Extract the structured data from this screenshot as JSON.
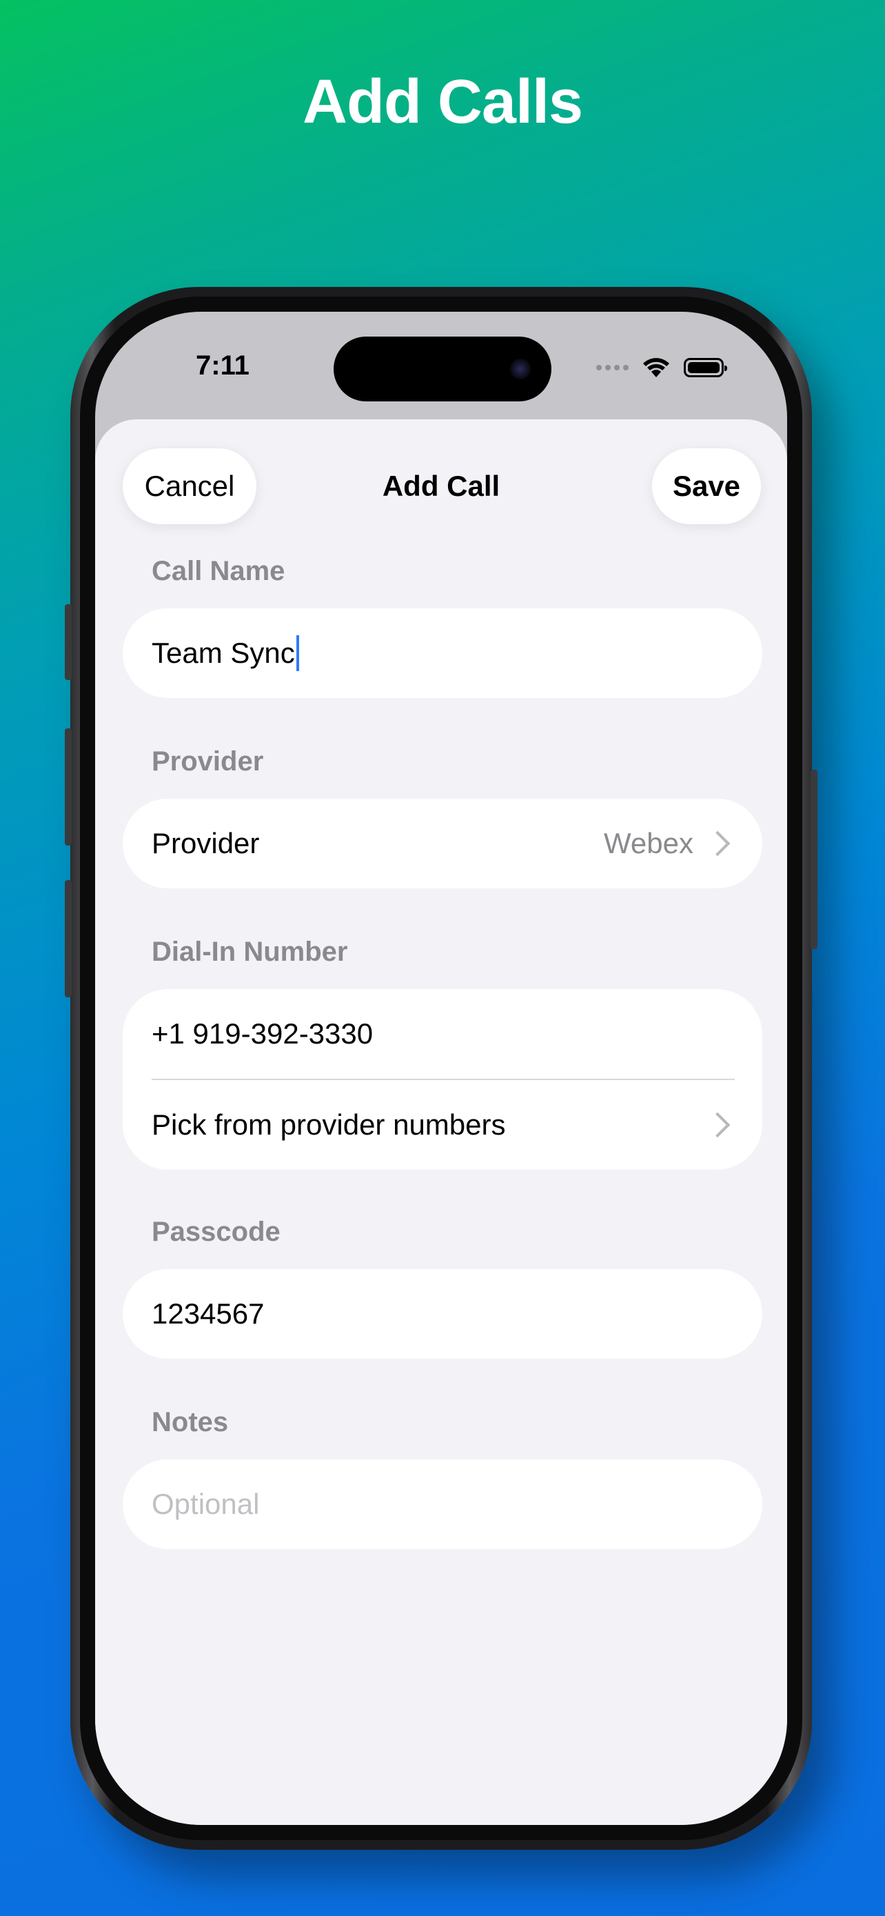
{
  "headline": "Add Calls",
  "status_bar": {
    "time": "7:11"
  },
  "nav": {
    "cancel_label": "Cancel",
    "title": "Add Call",
    "save_label": "Save"
  },
  "sections": {
    "call_name": {
      "label": "Call Name",
      "value": "Team Sync"
    },
    "provider": {
      "label": "Provider",
      "row_label": "Provider",
      "row_value": "Webex"
    },
    "dial_in": {
      "label": "Dial-In Number",
      "value": "+1 919-392-3330",
      "pick_label": "Pick from provider numbers"
    },
    "passcode": {
      "label": "Passcode",
      "value": "1234567"
    },
    "notes": {
      "label": "Notes",
      "value": "",
      "placeholder": "Optional"
    }
  },
  "icons": {
    "wifi": "wifi-icon",
    "battery": "battery-icon",
    "signal": "signal-dots-icon",
    "chevron": "chevron-right-icon"
  },
  "colors": {
    "background_top": "#05c161",
    "background_bottom": "#0a6ee0",
    "sheet": "#f2f2f7",
    "card": "#ffffff",
    "secondary_text": "#8a8a8e",
    "caret": "#2f7cf6"
  }
}
